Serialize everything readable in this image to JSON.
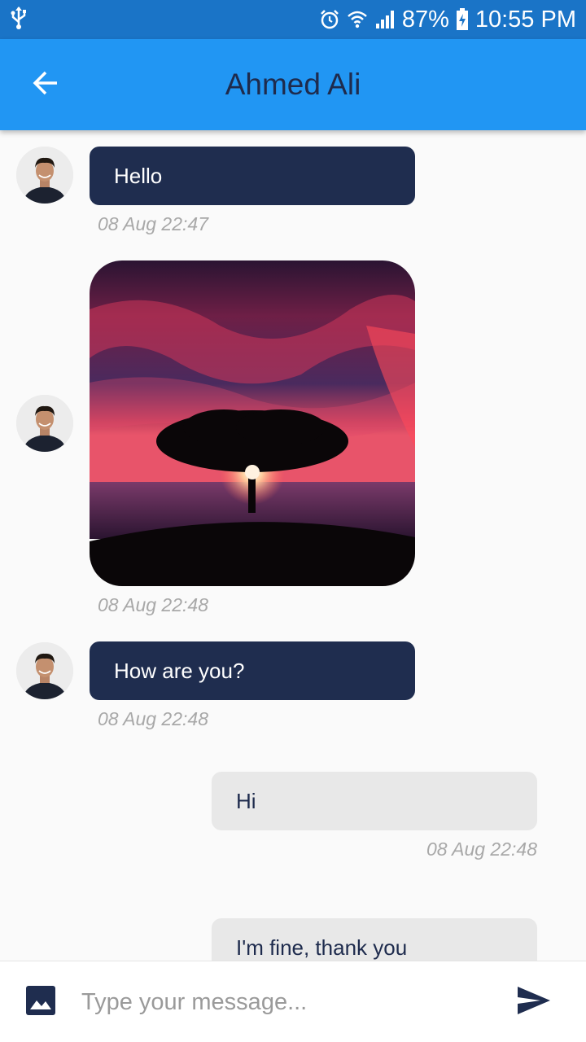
{
  "status_bar": {
    "usb_icon": "usb-icon",
    "alarm_icon": "alarm-icon",
    "wifi_icon": "wifi-icon",
    "signal_icon": "signal-icon",
    "battery_percent": "87%",
    "battery_icon": "battery-charging-icon",
    "time": "10:55 PM"
  },
  "app_bar": {
    "back_icon": "arrow-back-icon",
    "title": "Ahmed Ali",
    "color": "#2196f3"
  },
  "messages": [
    {
      "direction": "incoming",
      "type": "text",
      "text": "Hello",
      "time": "08 Aug 22:47"
    },
    {
      "direction": "incoming",
      "type": "image",
      "image": "sunset-tree-photo",
      "time": "08 Aug 22:48"
    },
    {
      "direction": "incoming",
      "type": "text",
      "text": "How are you?",
      "time": "08 Aug 22:48"
    },
    {
      "direction": "outgoing",
      "type": "text",
      "text": "Hi",
      "time": "08 Aug 22:48"
    },
    {
      "direction": "outgoing",
      "type": "text",
      "text": "I'm fine, thank you"
    }
  ],
  "composer": {
    "image_icon": "image-icon",
    "placeholder": "Type your message...",
    "value": "",
    "send_icon": "send-icon"
  },
  "colors": {
    "incoming_bubble": "#1f2d4f",
    "outgoing_bubble": "#e8e8e8",
    "title_text": "#1e2b4d"
  }
}
